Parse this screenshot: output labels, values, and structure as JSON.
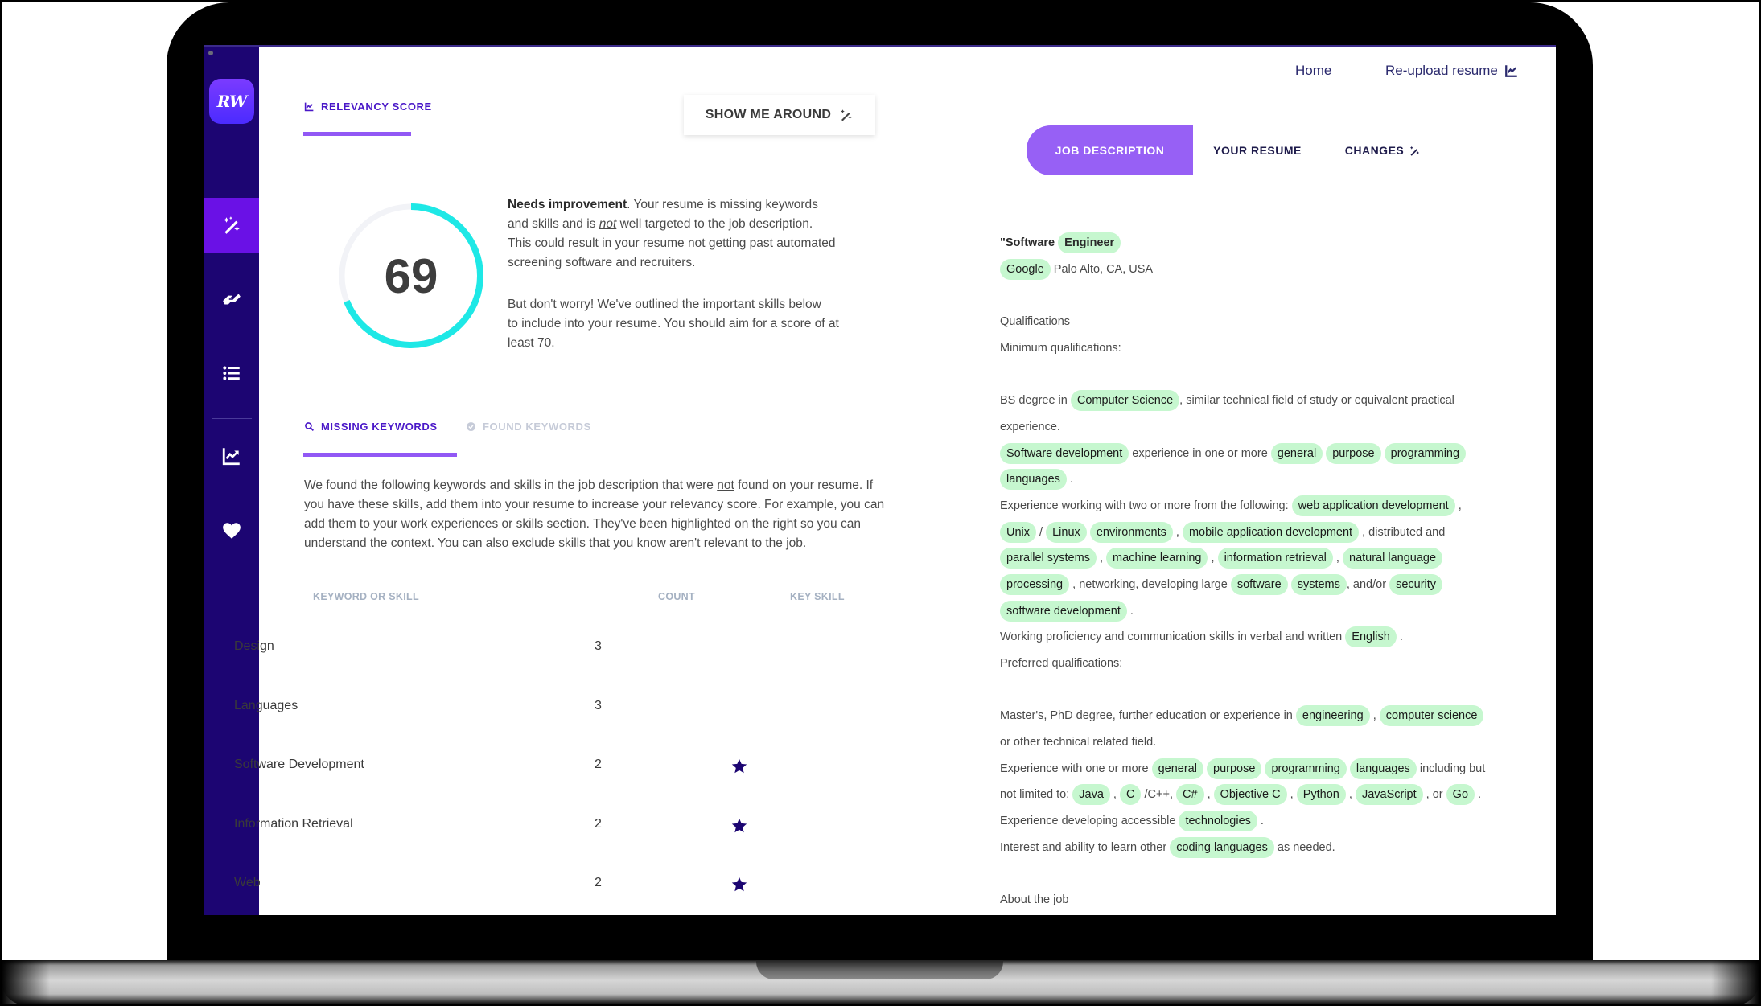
{
  "sidebar": {
    "logo": "RW",
    "items": [
      {
        "name": "magic-wand",
        "active": true
      },
      {
        "name": "handshake",
        "active": false
      },
      {
        "name": "list",
        "active": false
      },
      {
        "name": "chart",
        "active": false
      },
      {
        "name": "heart",
        "active": false
      }
    ]
  },
  "left": {
    "relevancy_tab": "RELEVANCY SCORE",
    "show_me_around": "SHOW ME AROUND",
    "score": {
      "value": "69",
      "fraction": 0.69,
      "ring_color": "#1ee8e6",
      "summary_bold": "Needs improvement",
      "summary_rest_1": ". Your resume is missing keywords",
      "summary_line_2a": "and skills and is ",
      "summary_not": "not",
      "summary_line_2b": " well targeted to the job description.",
      "summary_line_3": "This could result in your resume not getting past automated",
      "summary_line_4": "screening software and recruiters.",
      "advice_line_1": "But don't worry! We've outlined the important skills below",
      "advice_line_2": "to include into your resume. You should aim for a score of at",
      "advice_line_3": "least 70."
    },
    "keyword_tabs": {
      "missing": "MISSING KEYWORDS",
      "found": "FOUND KEYWORDS"
    },
    "intro": {
      "line1a": "We found the following keywords and skills in the job description that were ",
      "line1_not": "not",
      "line1b": " found on your resume. If",
      "line2": "you have these skills, add them into your resume to increase your relevancy score. For example, you can",
      "line3": "add them to your work experiences or skills section. They've been highlighted on the right so you can",
      "line4": "understand the context. You can also exclude skills that you know aren't relevant to the job."
    },
    "table": {
      "headers": [
        "KEYWORD OR SKILL",
        "COUNT",
        "KEY SKILL"
      ],
      "rows": [
        {
          "keyword": "Design",
          "count": "3",
          "key_skill": false
        },
        {
          "keyword": "Languages",
          "count": "3",
          "key_skill": false
        },
        {
          "keyword": "Software Development",
          "count": "2",
          "key_skill": true
        },
        {
          "keyword": "Information Retrieval",
          "count": "2",
          "key_skill": true
        },
        {
          "keyword": "Web",
          "count": "2",
          "key_skill": true
        }
      ]
    }
  },
  "right": {
    "nav": {
      "home": "Home",
      "reupload": "Re-upload resume"
    },
    "tabs": [
      "JOB DESCRIPTION",
      "YOUR RESUME",
      "CHANGES"
    ],
    "highlight_color": "#c6f7cf",
    "job": {
      "title_quote": "\"Software",
      "title_hl": "Engineer",
      "company": "Google",
      "location": "Palo Alto, CA, USA",
      "qualifications": "Qualifications",
      "min_quals": "Minimum qualifications:",
      "pref_quals": "Preferred qualifications:",
      "about": "About the job",
      "lines": [
        [
          [
            "t",
            "BS degree in "
          ],
          [
            "h",
            "Computer Science"
          ],
          [
            "t",
            ", similar technical field of study or equivalent practical"
          ]
        ],
        [
          [
            "t",
            "experience."
          ]
        ],
        [
          [
            "h",
            "Software development"
          ],
          [
            "t",
            " experience in one or more "
          ],
          [
            "h",
            "general"
          ],
          [
            "t",
            " "
          ],
          [
            "h",
            "purpose"
          ],
          [
            "t",
            " "
          ],
          [
            "h",
            "programming"
          ]
        ],
        [
          [
            "h",
            "languages"
          ],
          [
            "t",
            " ."
          ]
        ],
        [
          [
            "t",
            "Experience working with two or more from the following: "
          ],
          [
            "h",
            "web application development"
          ],
          [
            "t",
            " ,"
          ]
        ],
        [
          [
            "h",
            "Unix"
          ],
          [
            "t",
            " / "
          ],
          [
            "h",
            "Linux"
          ],
          [
            "t",
            " "
          ],
          [
            "h",
            "environments"
          ],
          [
            "t",
            " , "
          ],
          [
            "h",
            "mobile application development"
          ],
          [
            "t",
            " , distributed and"
          ]
        ],
        [
          [
            "h",
            "parallel systems"
          ],
          [
            "t",
            " , "
          ],
          [
            "h",
            "machine learning"
          ],
          [
            "t",
            " , "
          ],
          [
            "h",
            "information retrieval"
          ],
          [
            "t",
            " , "
          ],
          [
            "h",
            "natural language"
          ]
        ],
        [
          [
            "h",
            "processing"
          ],
          [
            "t",
            " , networking, developing large "
          ],
          [
            "h",
            "software"
          ],
          [
            "t",
            " "
          ],
          [
            "h",
            "systems"
          ],
          [
            "t",
            ", and/or "
          ],
          [
            "h",
            "security"
          ]
        ],
        [
          [
            "h",
            "software development"
          ],
          [
            "t",
            " ."
          ]
        ],
        [
          [
            "t",
            "Working proficiency and communication skills in verbal and written "
          ],
          [
            "h",
            "English"
          ],
          [
            "t",
            " ."
          ]
        ]
      ],
      "pref_lines": [
        [
          [
            "t",
            "Master's, PhD degree, further education or experience in "
          ],
          [
            "h",
            "engineering"
          ],
          [
            "t",
            " , "
          ],
          [
            "h",
            "computer science"
          ]
        ],
        [
          [
            "t",
            "or other technical related field."
          ]
        ],
        [
          [
            "t",
            "Experience with one or more "
          ],
          [
            "h",
            "general"
          ],
          [
            "t",
            " "
          ],
          [
            "h",
            "purpose"
          ],
          [
            "t",
            " "
          ],
          [
            "h",
            "programming"
          ],
          [
            "t",
            " "
          ],
          [
            "h",
            "languages"
          ],
          [
            "t",
            " including but"
          ]
        ],
        [
          [
            "t",
            "not limited to: "
          ],
          [
            "h",
            "Java"
          ],
          [
            "t",
            " , "
          ],
          [
            "h",
            "C"
          ],
          [
            "t",
            " /C++, "
          ],
          [
            "h",
            "C#"
          ],
          [
            "t",
            " , "
          ],
          [
            "h",
            "Objective C"
          ],
          [
            "t",
            " , "
          ],
          [
            "h",
            "Python"
          ],
          [
            "t",
            " , "
          ],
          [
            "h",
            "JavaScript"
          ],
          [
            "t",
            " , or "
          ],
          [
            "h",
            "Go"
          ],
          [
            "t",
            " ."
          ]
        ],
        [
          [
            "t",
            "Experience developing accessible "
          ],
          [
            "h",
            "technologies"
          ],
          [
            "t",
            " ."
          ]
        ],
        [
          [
            "t",
            "Interest and ability to learn other "
          ],
          [
            "h",
            "coding languages"
          ],
          [
            "t",
            " as needed."
          ]
        ]
      ]
    }
  }
}
